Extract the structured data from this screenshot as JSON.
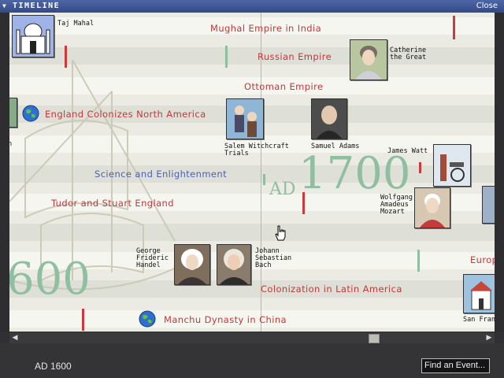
{
  "window": {
    "title": "TIMELINE",
    "close_label": "Close"
  },
  "events": {
    "mughal": "Mughal Empire in India",
    "russian": "Russian Empire",
    "ottoman": "Ottoman Empire",
    "england_colonizes": "England Colonizes North America",
    "science": "Science and Enlightenment",
    "tudor": "Tudor and Stuart England",
    "latin_america": "Colonization in Latin America",
    "manchu": "Manchu Dynasty in China",
    "europe_partial": "Europ"
  },
  "people": {
    "taj_mahal": "Taj Mahal",
    "catherine": "Catherine\nthe Great",
    "salem": "Salem Witchcraft\nTrials",
    "samuel_adams": "Samuel Adams",
    "james_watt": "James Watt",
    "mozart": "Wolfgang\nAmadeus\nMozart",
    "handel": "George\nFrideric\nHandel",
    "bach": "Johann\nSebastian\nBach",
    "san_fran": "San Fran",
    "left_cut": "n"
  },
  "year_markers": {
    "ad1700_prefix": "AD",
    "ad1700_year": "1700",
    "big_1600": "600"
  },
  "footer": {
    "current_date": "AD 1600",
    "find_button": "Find an Event..."
  },
  "colors": {
    "event_red": "#c0393b",
    "event_blue": "#4f60b0",
    "year_green": "#8fbfa0",
    "titlebar": "#3c5394"
  }
}
